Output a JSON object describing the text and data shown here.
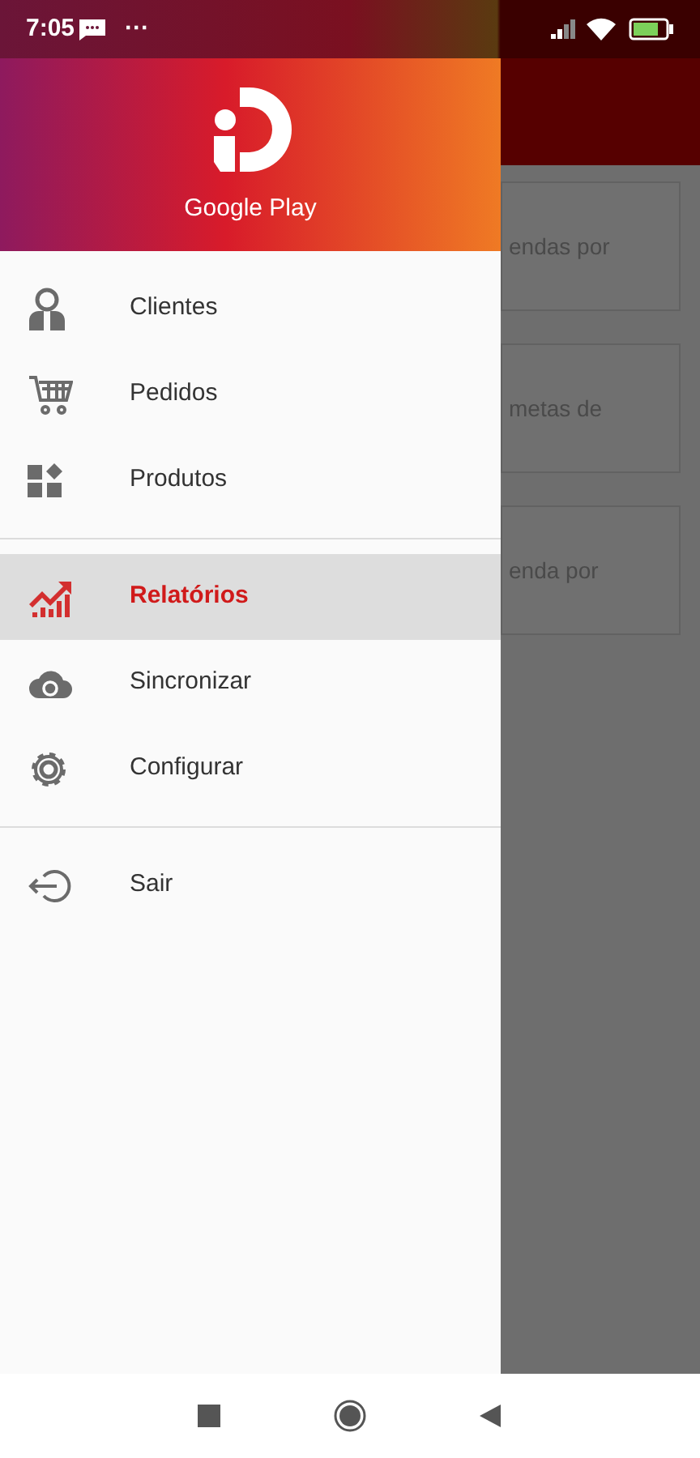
{
  "status_bar": {
    "time": "7:05",
    "more": "···"
  },
  "drawer": {
    "header": {
      "title": "Google Play"
    },
    "sections": [
      {
        "items": [
          {
            "label": "Clientes",
            "selected": false
          },
          {
            "label": "Pedidos",
            "selected": false
          },
          {
            "label": "Produtos",
            "selected": false
          }
        ]
      },
      {
        "items": [
          {
            "label": "Relatórios",
            "selected": true
          },
          {
            "label": "Sincronizar",
            "selected": false
          },
          {
            "label": "Configurar",
            "selected": false
          }
        ]
      },
      {
        "items": [
          {
            "label": "Sair",
            "selected": false
          }
        ]
      }
    ]
  },
  "background_cards": [
    {
      "text": "endas por"
    },
    {
      "text": "metas de"
    },
    {
      "text": "enda por"
    }
  ]
}
